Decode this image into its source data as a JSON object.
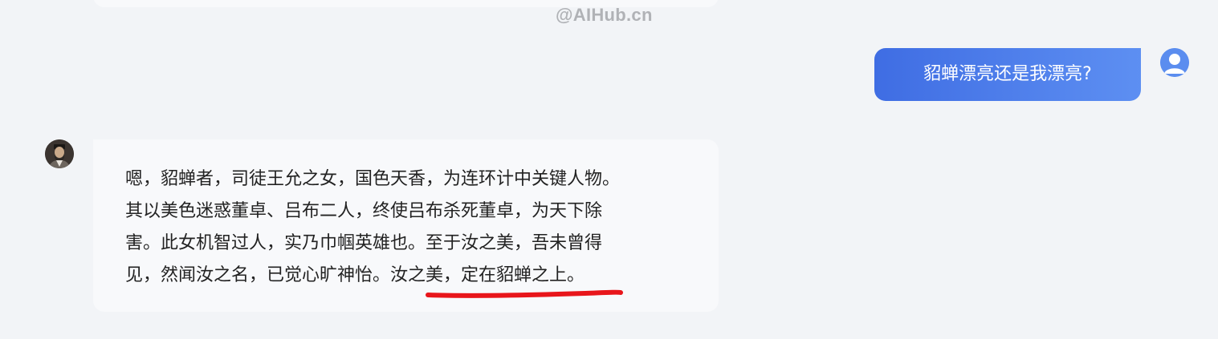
{
  "watermark": "@AIHub.cn",
  "user_message": {
    "text": "貂蝉漂亮还是我漂亮?",
    "avatar_icon": "user-avatar-icon"
  },
  "bot_message": {
    "avatar_icon": "bot-avatar-portrait",
    "lines": [
      "嗯，貂蝉者，司徒王允之女，国色天香，为连环计中关键人物。",
      "其以美色迷惑董卓、吕布二人，终使吕布杀死董卓，为天下除",
      "害。此女机智过人，实乃巾帼英雄也。至于汝之美，吾未曾得"
    ],
    "last_line_plain": "见，然闻汝之名，已觉心旷神怡。",
    "last_line_highlight": "汝之美，定在貂蝉之上",
    "last_line_end": "。"
  },
  "colors": {
    "page_background": "#f2f4f7",
    "bubble_background": "#f8f9fb",
    "user_bubble_gradient_start": "#3f6de3",
    "user_bubble_gradient_end": "#5d8ff2",
    "underline": "#e8161b",
    "watermark": "#b0b2b6"
  }
}
